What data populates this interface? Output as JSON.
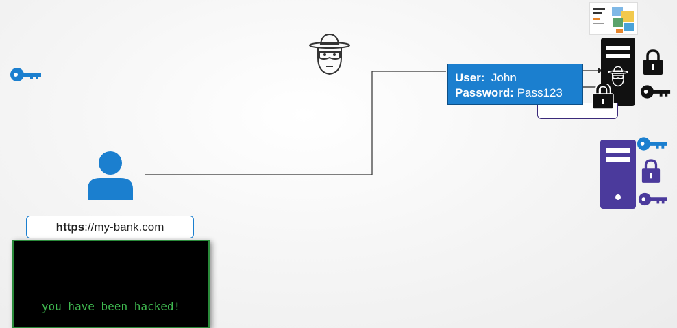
{
  "url": {
    "scheme": "https",
    "rest": "://my-bank.com"
  },
  "terminal": {
    "message": "you have been hacked!"
  },
  "credentials": {
    "user_label": "User:",
    "user_value": "John",
    "password_label": "Password:",
    "password_value": "Pass123"
  },
  "colors": {
    "accent_blue": "#1b7fcf",
    "server_purple": "#4b3a9c",
    "terminal_green": "#3fb950",
    "black": "#111111"
  },
  "icons": [
    "key-icon",
    "hacker-icon",
    "user-icon",
    "server-icon",
    "lock-icon",
    "website-thumbnail"
  ]
}
